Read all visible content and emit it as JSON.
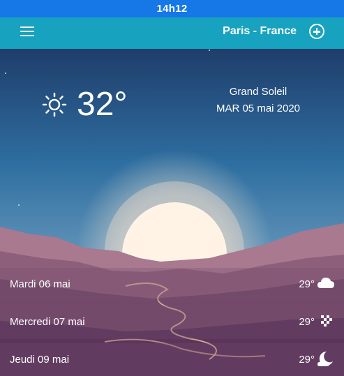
{
  "status_bar": {
    "time": "14h12"
  },
  "header": {
    "location": "Paris - France",
    "menu_icon": "menu-icon",
    "add_icon": "add-location-icon"
  },
  "current": {
    "icon": "sun-icon",
    "temperature": "32°",
    "condition": "Grand Soleil",
    "date": "MAR 05 mai 2020"
  },
  "forecast": [
    {
      "day": "Mardi 06 mai",
      "temperature": "29°",
      "icon": "cloud-icon"
    },
    {
      "day": "Mercredi 07 mai",
      "temperature": "29°",
      "icon": "hail-icon"
    },
    {
      "day": "Jeudi 09 mai",
      "temperature": "29°",
      "icon": "moon-cloud-icon"
    }
  ]
}
